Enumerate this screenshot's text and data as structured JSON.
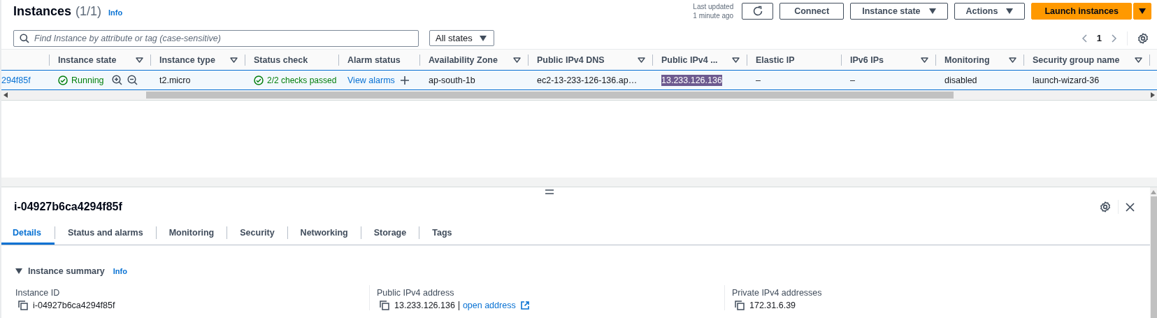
{
  "header": {
    "title": "Instances",
    "count": "(1/1)",
    "info": "Info",
    "last_updated": [
      "Last updated",
      "1 minute ago"
    ],
    "buttons": [
      {
        "label": "Connect",
        "kind": "plain"
      },
      {
        "label": "Instance state",
        "kind": "dropdown"
      },
      {
        "label": "Actions",
        "kind": "dropdown"
      },
      {
        "label": "Launch instances",
        "kind": "primary"
      }
    ]
  },
  "search": {
    "placeholder": "Find Instance by attribute or tag (case-sensitive)"
  },
  "state_filter": {
    "value": "All states"
  },
  "pagination": {
    "page": "1"
  },
  "table": {
    "columns": [
      {
        "filter": false
      },
      {
        "label": "Instance state",
        "filter": true
      },
      {
        "label": "Instance type",
        "filter": true
      },
      {
        "label": "Status check",
        "filter": false
      },
      {
        "label": "Alarm status",
        "filter": false
      },
      {
        "label": "Availability Zone",
        "filter": true
      },
      {
        "label": "Public IPv4 DNS",
        "filter": true
      },
      {
        "label": "Public IPv4 ...",
        "filter": true
      },
      {
        "label": "Elastic IP",
        "filter": false
      },
      {
        "label": "IPv6 IPs",
        "filter": true
      },
      {
        "label": "Monitoring",
        "filter": true
      },
      {
        "label": "Security group name",
        "filter": true
      }
    ],
    "rows": [
      {
        "selected": true,
        "cells": [
          {
            "kind": "link",
            "text": "294f85f"
          },
          {
            "kind": "state",
            "text": "Running"
          },
          {
            "kind": "text",
            "text": "t2.micro"
          },
          {
            "kind": "check",
            "text": "2/2 checks passed"
          },
          {
            "kind": "alarm",
            "text": "View alarms"
          },
          {
            "kind": "text",
            "text": "ap-south-1b"
          },
          {
            "kind": "text",
            "text": "ec2-13-233-126-136.ap…"
          },
          {
            "kind": "highlighted",
            "text": "13.233.126.136"
          },
          {
            "kind": "text",
            "text": "–"
          },
          {
            "kind": "text",
            "text": "–"
          },
          {
            "kind": "text",
            "text": "disabled"
          },
          {
            "kind": "text",
            "text": "launch-wizard-36"
          }
        ]
      }
    ]
  },
  "details": {
    "title": "i-04927b6ca4294f85f",
    "tabs": [
      {
        "label": "Details",
        "selected": true
      },
      {
        "label": "Status and alarms",
        "selected": false
      },
      {
        "label": "Monitoring",
        "selected": false
      },
      {
        "label": "Security",
        "selected": false
      },
      {
        "label": "Networking",
        "selected": false
      },
      {
        "label": "Storage",
        "selected": false
      },
      {
        "label": "Tags",
        "selected": false
      }
    ],
    "section": {
      "title": "Instance summary",
      "info": "Info",
      "expanded": true,
      "fields": [
        {
          "label": "Instance ID",
          "value": "i-04927b6ca4294f85f"
        },
        {
          "label": "Public IPv4 address",
          "value": "13.233.126.136",
          "link": "open address"
        },
        {
          "label": "Private IPv4 addresses",
          "value": "172.31.6.39"
        }
      ]
    }
  }
}
